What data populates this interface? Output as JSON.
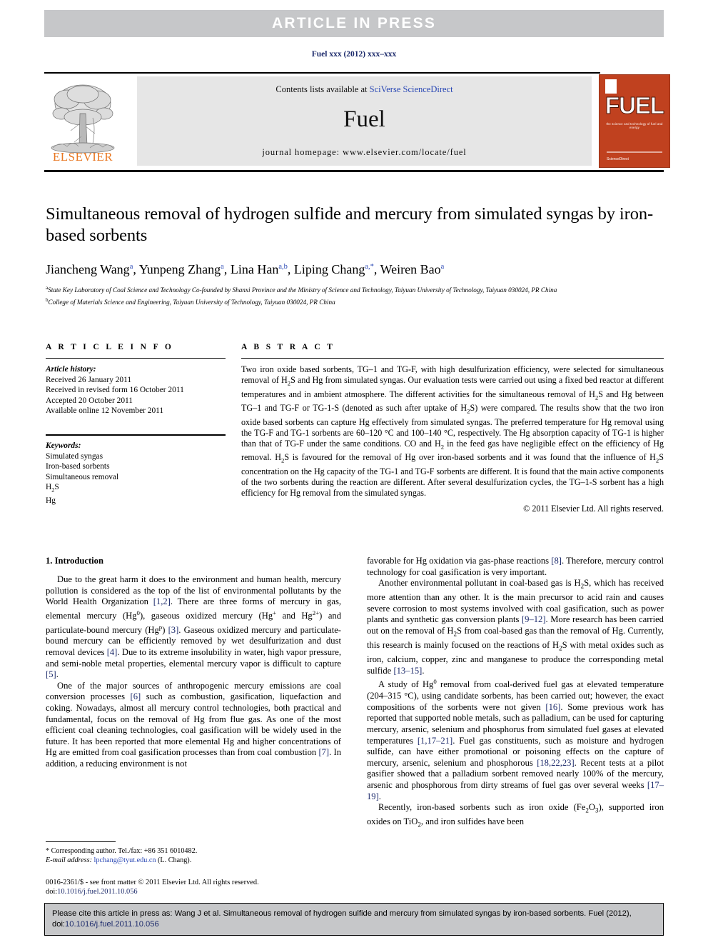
{
  "banner": {
    "text": "ARTICLE  IN  PRESS"
  },
  "running_head": "Fuel xxx (2012) xxx–xxx",
  "masthead": {
    "publisher": "ELSEVIER",
    "contents_prefix": "Contents lists available at ",
    "contents_link": "SciVerse ScienceDirect",
    "journal": "Fuel",
    "homepage": "journal homepage: www.elsevier.com/locate/fuel",
    "cover": {
      "title": "FUEL",
      "subtitle": "the science and technology of fuel and energy",
      "footer": "ScienceDirect"
    }
  },
  "article": {
    "title": "Simultaneous removal of hydrogen sulfide and mercury from simulated syngas by iron-based sorbents",
    "authors_html": "Jiancheng Wang<sup>a</sup>, Yunpeng Zhang<sup>a</sup>, Lina Han<sup>a,b</sup>, Liping Chang<sup>a,*</sup>, Weiren Bao<sup>a</sup>",
    "affiliations": [
      "State Key Laboratory of Coal Science and Technology Co-founded by Shanxi Province and the Ministry of Science and Technology, Taiyuan University of Technology, Taiyuan 030024, PR China",
      "College of Materials Science and Engineering, Taiyuan University of Technology, Taiyuan 030024, PR China"
    ],
    "affiliation_marks": [
      "a",
      "b"
    ]
  },
  "info": {
    "heading": "A R T I C L E   I N F O",
    "history_label": "Article history:",
    "history": [
      "Received 26 January 2011",
      "Received in revised form 16 October 2011",
      "Accepted 20 October 2011",
      "Available online 12 November 2011"
    ],
    "keywords_label": "Keywords:",
    "keywords_html": [
      "Simulated syngas",
      "Iron-based sorbents",
      "Simultaneous removal",
      "H<sub>2</sub>S",
      "Hg"
    ]
  },
  "abstract": {
    "heading": "A B S T R A C T",
    "body_html": "Two iron oxide based sorbents, TG–1 and TG-F, with high desulfurization efficiency, were selected for simultaneous removal of H<sub>2</sub>S and Hg from simulated syngas. Our evaluation tests were carried out using a fixed bed reactor at different temperatures and in ambient atmosphere. The different activities for the simultaneous removal of H<sub>2</sub>S and Hg between TG–1 and TG-F or TG-1-S (denoted as such after uptake of H<sub>2</sub>S) were compared. The results show that the two iron oxide based sorbents can capture Hg effectively from simulated syngas. The preferred temperature for Hg removal using the TG-F and TG-1 sorbents are 60–120 °C and 100–140 °C, respectively. The Hg absorption capacity of TG-1 is higher than that of TG-F under the same conditions. CO and H<sub>2</sub> in the feed gas have negligible effect on the efficiency of Hg removal. H<sub>2</sub>S is favoured for the removal of Hg over iron-based sorbents and it was found that the influence of H<sub>2</sub>S concentration on the Hg capacity of the TG-1 and TG-F sorbents are different. It is found that the main active components of the two sorbents during the reaction are different. After several desulfurization cycles, the TG–1-S sorbent has a high efficiency for Hg removal from the simulated syngas.",
    "copyright": "© 2011 Elsevier Ltd. All rights reserved."
  },
  "body": {
    "section_heading": "1. Introduction",
    "left_paragraphs_html": [
      "Due to the great harm it does to the environment and human health, mercury pollution is considered as the top of the list of environmental pollutants by the World Health Organization <span class=\"ref\">[1,2]</span>. There are three forms of mercury in gas, elemental mercury (Hg<sup class=\"inl\">0</sup>), gaseous oxidized mercury (Hg<sup class=\"inl\">+</sup> and Hg<sup class=\"inl\">2+</sup>) and particulate-bound mercury (Hg<sup class=\"inl\">p</sup>) <span class=\"ref\">[3]</span>. Gaseous oxidized mercury and particulate-bound mercury can be efficiently removed by wet desulfurization and dust removal devices <span class=\"ref\">[4]</span>. Due to its extreme insolubility in water, high vapor pressure, and semi-noble metal properties, elemental mercury vapor is difficult to capture <span class=\"ref\">[5]</span>.",
      "One of the major sources of anthropogenic mercury emissions are coal conversion processes <span class=\"ref\">[6]</span> such as combustion, gasification, liquefaction and coking. Nowadays, almost all mercury control technologies, both practical and fundamental, focus on the removal of Hg from flue gas. As one of the most efficient coal cleaning technologies, coal gasification will be widely used in the future. It has been reported that more elemental Hg and higher concentrations of Hg are emitted from coal gasification processes than from coal combustion <span class=\"ref\">[7]</span>. In addition, a reducing environment is not"
    ],
    "right_paragraphs_html": [
      "favorable for Hg oxidation via gas-phase reactions <span class=\"ref\">[8]</span>. Therefore, mercury control technology for coal gasification is very important.",
      "Another environmental pollutant in coal-based gas is H<sub>2</sub>S, which has received more attention than any other. It is the main precursor to acid rain and causes severe corrosion to most systems involved with coal gasification, such as power plants and synthetic gas conversion plants <span class=\"ref\">[9–12]</span>. More research has been carried out on the removal of H<sub>2</sub>S from coal-based gas than the removal of Hg. Currently, this research is mainly focused on the reactions of H<sub>2</sub>S with metal oxides such as iron, calcium, copper, zinc and manganese to produce the corresponding metal sulfide <span class=\"ref\">[13–15]</span>.",
      "A study of Hg<sup class=\"inl\">0</sup> removal from coal-derived fuel gas at elevated temperature (204–315 °C), using candidate sorbents, has been carried out; however, the exact compositions of the sorbents were not given <span class=\"ref\">[16]</span>. Some previous work has reported that supported noble metals, such as palladium, can be used for capturing mercury, arsenic, selenium and phosphorus from simulated fuel gases at elevated temperatures <span class=\"ref\">[1,17–21]</span>. Fuel gas constituents, such as moisture and hydrogen sulfide, can have either promotional or poisoning effects on the capture of mercury, arsenic, selenium and phosphorous <span class=\"ref\">[18,22,23]</span>. Recent tests at a pilot gasifier showed that a palladium sorbent removed nearly 100% of the mercury, arsenic and phosphorous from dirty streams of fuel gas over several weeks <span class=\"ref\">[17–19]</span>.",
      "Recently, iron-based sorbents such as iron oxide (Fe<sub>2</sub>O<sub>3</sub>), supported iron oxides on TiO<sub>2</sub>, and iron sulfides have been"
    ]
  },
  "footnote": {
    "corresponding_html": "* Corresponding author. Tel./fax: +86 351 6010482.",
    "email_label": "E-mail address:",
    "email": "lpchang@tyut.edu.cn",
    "email_suffix": "(L. Chang)."
  },
  "issn": {
    "line1": "0016-2361/$ - see front matter © 2011 Elsevier Ltd. All rights reserved.",
    "doi_prefix": "doi:",
    "doi": "10.1016/j.fuel.2011.10.056"
  },
  "cite_box": {
    "text_before": "Please cite this article in press as: Wang J et al. Simultaneous removal of hydrogen sulfide and mercury from simulated syngas by iron-based sorbents. Fuel (2012), doi:",
    "doi": "10.1016/j.fuel.2011.10.056"
  }
}
